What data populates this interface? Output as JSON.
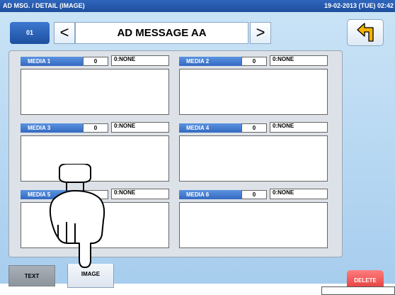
{
  "header": {
    "title": "AD MSG. / DETAIL (IMAGE)",
    "datetime": "19-02-2013 (TUE) 02:42"
  },
  "record": {
    "id": "01",
    "prev_symbol": "<",
    "next_symbol": ">",
    "name": "AD MESSAGE AA"
  },
  "media": [
    {
      "label": "MEDIA 1",
      "number": "0",
      "type": "0:NONE"
    },
    {
      "label": "MEDIA 2",
      "number": "0",
      "type": "0:NONE"
    },
    {
      "label": "MEDIA 3",
      "number": "0",
      "type": "0:NONE"
    },
    {
      "label": "MEDIA 4",
      "number": "0",
      "type": "0:NONE"
    },
    {
      "label": "MEDIA 5",
      "number": "",
      "type": "0:NONE"
    },
    {
      "label": "MEDIA 6",
      "number": "0",
      "type": "0:NONE"
    }
  ],
  "tabs": {
    "text_label": "TEXT",
    "image_label": "IMAGE"
  },
  "actions": {
    "delete_label": "DELETE"
  },
  "colors": {
    "accent": "#2f66bd",
    "screen": "#b8d8f2",
    "delete": "#e84a4a"
  },
  "icons": {
    "back": "return-arrow-icon",
    "pointer": "pointing-hand-icon"
  }
}
